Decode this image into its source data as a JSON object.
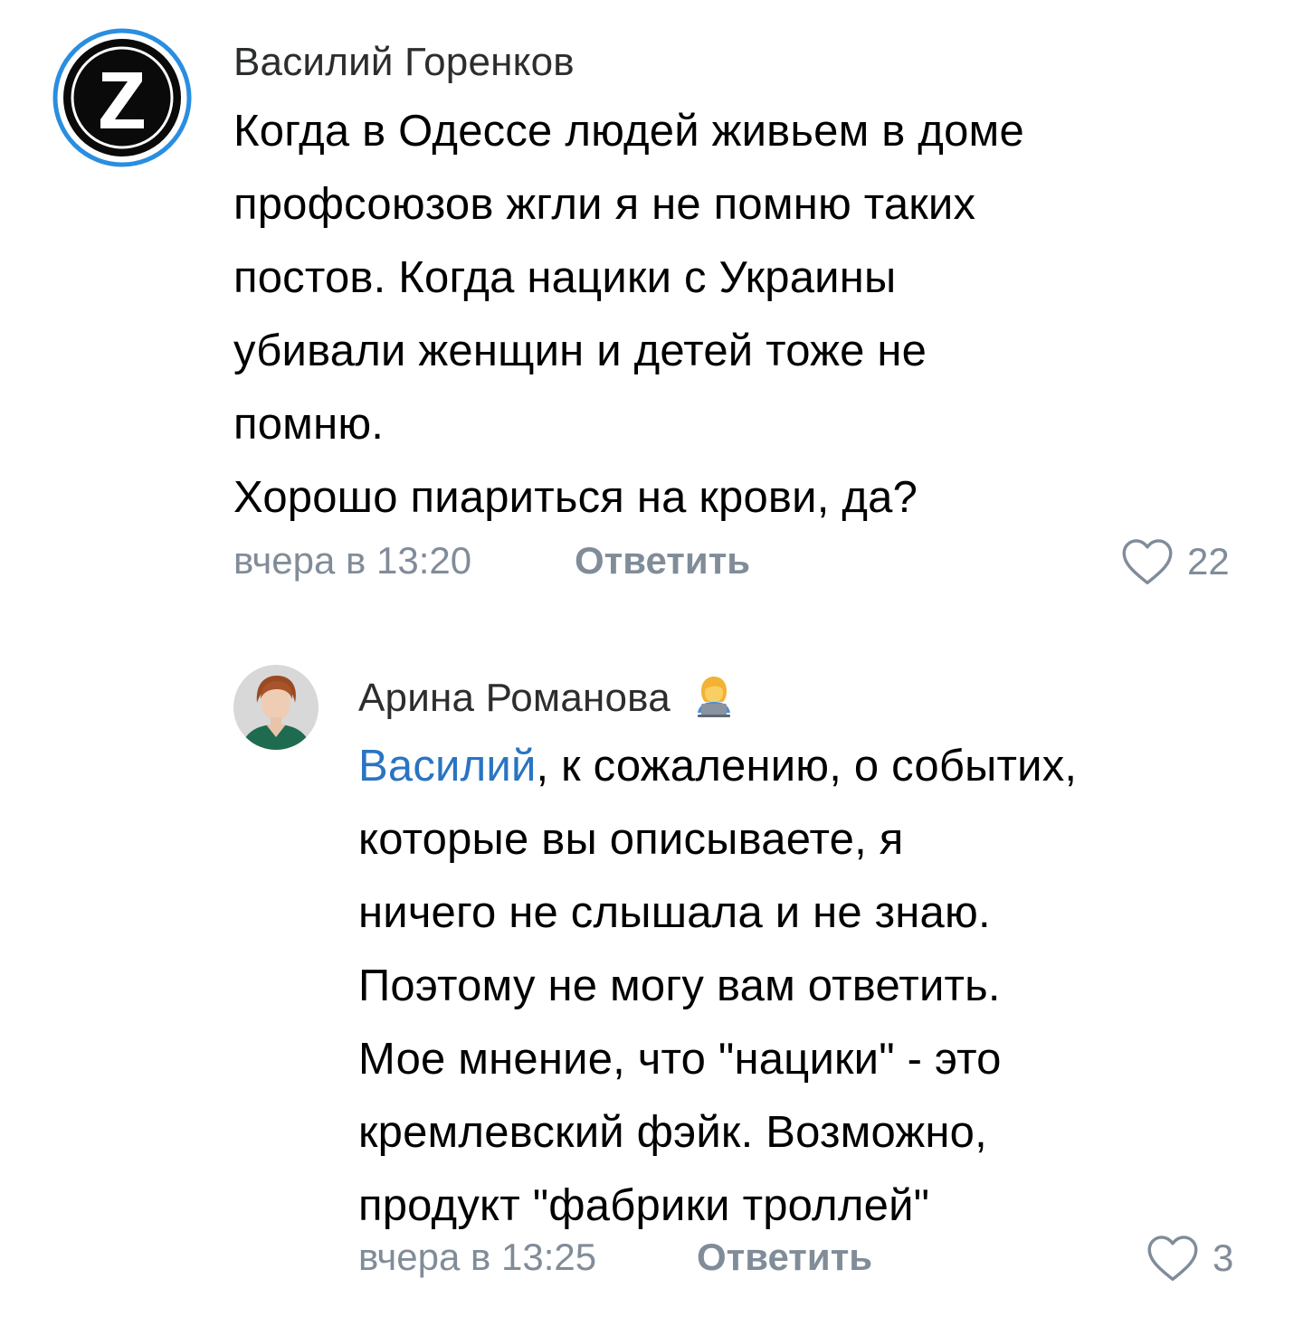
{
  "comments": [
    {
      "author": "Василий Горенков",
      "avatar": "z-logo-avatar",
      "lines": [
        "Когда в Одессе людей живьем в доме",
        "профсоюзов жгли я не помню таких",
        "постов. Когда нацики с Украины",
        "убивали женщин и детей тоже не",
        "помню.",
        "Хорошо пиариться на крови, да?"
      ],
      "time": "вчера в 13:20",
      "reply_label": "Ответить",
      "like_icon": "heart-outline-icon",
      "likes": "22"
    },
    {
      "author": "Арина Романова",
      "author_badge": "person-with-laptop-emoji",
      "avatar": "woman-photo-avatar",
      "mention": "Василий",
      "first_line_rest": ", к сожалению, о событих,",
      "lines": [
        "которые вы описываете, я",
        "ничего не слышала и не знаю.",
        "Поэтому не могу вам ответить.",
        "Мое мнение, что \"нацики\" - это",
        "кремлевский фэйк. Возможно,",
        "продукт \"фабрики троллей\""
      ],
      "time": "вчера в 13:25",
      "reply_label": "Ответить",
      "like_icon": "heart-outline-icon",
      "likes": "3"
    }
  ],
  "colors": {
    "text": "#000000",
    "author": "#2c2d2e",
    "secondary": "#818c99",
    "mention": "#2a74c2",
    "avatar_ring": "#2a8ee0"
  }
}
